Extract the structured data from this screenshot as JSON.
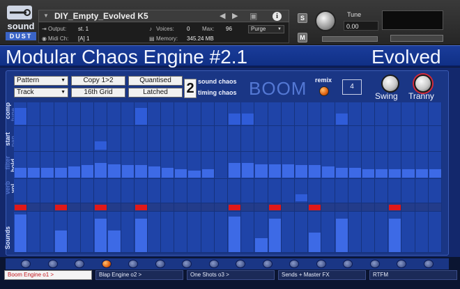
{
  "header": {
    "instrument_name": "DIY_Empty_Evolved K5",
    "output_label": "Output:",
    "output_value": "st. 1",
    "midi_label": "Midi Ch:",
    "midi_value": "[A]  1",
    "voices_label": "Voices:",
    "voices_value": "0",
    "max_label": "Max:",
    "max_value": "96",
    "memory_label": "Memory:",
    "memory_value": "345.24 MB",
    "purge_label": "Purge",
    "solo_label": "S",
    "mute_label": "M",
    "tune_label": "Tune",
    "tune_value": "0.00",
    "info_label": "i"
  },
  "brand": {
    "line1": "sound",
    "line2": "DUST"
  },
  "title": {
    "main": "Modular Chaos Engine #2.1",
    "right": "Evolved"
  },
  "controls": {
    "dropdown_pattern": "Pattern",
    "dropdown_track": "Track",
    "copy_button": "Copy 1>2",
    "grid_button": "16th Grid",
    "quantised_button": "Quantised",
    "latched_button": "Latched",
    "chaos_number": "2",
    "sound_chaos": "sound chaos",
    "timing_chaos": "timing chaos",
    "boom": "BOOM",
    "remix": "remix",
    "remix_value": "4",
    "swing": "Swing",
    "tranny": "Tranny"
  },
  "rows": {
    "comp": "comp",
    "tune": "tune",
    "start": "start",
    "pan": "pan",
    "filter": "filter",
    "hold": "hold",
    "verb": "verb",
    "vol": "vol",
    "sounds": "Sounds"
  },
  "sequencer": {
    "steps": 32,
    "comp_tune": [
      1,
      0,
      0,
      0,
      0,
      0,
      0,
      0,
      0,
      1,
      0,
      0,
      0,
      0,
      0,
      0,
      0,
      0,
      0,
      0,
      0,
      0,
      0,
      0,
      0,
      0,
      0,
      0,
      0,
      0,
      0,
      0
    ],
    "comp_tune_extra": [
      0,
      0,
      0,
      0,
      0,
      0,
      0,
      0,
      0,
      0,
      0,
      0,
      0,
      0,
      0,
      0,
      1,
      1,
      0,
      0,
      0,
      0,
      0,
      0,
      1,
      0,
      0,
      0,
      0,
      0,
      0,
      0
    ],
    "start_pan": [
      0,
      0,
      0,
      0,
      0,
      0,
      1,
      0,
      0,
      0,
      0,
      0,
      0,
      0,
      0,
      0,
      0,
      0,
      0,
      0,
      0,
      0,
      0,
      0,
      0,
      0,
      0,
      0,
      0,
      0,
      0,
      0
    ],
    "hold_levels": [
      0.35,
      0.35,
      0.35,
      0.35,
      0.4,
      0.45,
      0.55,
      0.5,
      0.45,
      0.45,
      0.4,
      0.35,
      0.3,
      0.25,
      0.3,
      0,
      0.55,
      0.55,
      0.5,
      0.5,
      0.5,
      0.45,
      0.45,
      0.4,
      0.35,
      0.35,
      0.3,
      0.3,
      0.3,
      0.3,
      0.3,
      0.3
    ],
    "vol_hits": [
      0,
      0,
      0,
      0,
      0,
      0,
      0,
      0,
      0,
      0,
      0,
      0,
      0,
      0,
      0,
      0,
      0,
      0,
      0,
      0,
      0,
      1,
      0,
      0,
      0,
      0,
      0,
      0,
      0,
      0,
      0,
      0
    ],
    "red_hits": [
      1,
      0,
      0,
      1,
      0,
      0,
      1,
      0,
      0,
      1,
      0,
      0,
      0,
      0,
      0,
      0,
      1,
      0,
      0,
      1,
      0,
      0,
      1,
      0,
      0,
      0,
      0,
      0,
      1,
      0,
      0,
      0
    ],
    "sound_levels": [
      0.95,
      0,
      0,
      0.55,
      0,
      0,
      0.85,
      0.55,
      0,
      0.85,
      0,
      0,
      0,
      0,
      0,
      0,
      0.9,
      0,
      0.35,
      0.85,
      0,
      0,
      0.5,
      0,
      0.85,
      0,
      0,
      0,
      0.85,
      0,
      0,
      0
    ]
  },
  "tabs": [
    {
      "label": "Boom Engine o1 >",
      "active": true
    },
    {
      "label": "Blap Engine o2 >",
      "active": false
    },
    {
      "label": "One Shots o3 >",
      "active": false
    },
    {
      "label": "Sends + Master FX",
      "active": false
    },
    {
      "label": "RTFM",
      "active": false
    }
  ]
}
